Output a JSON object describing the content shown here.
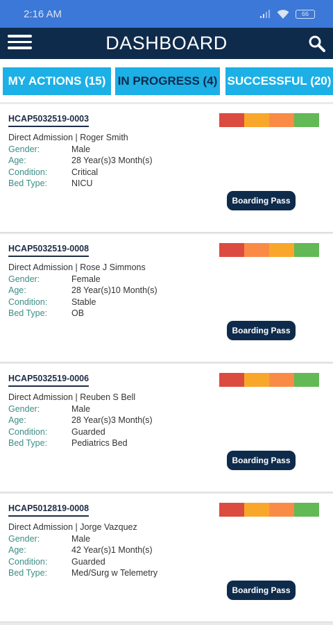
{
  "status_bar": {
    "time": "2:16 AM",
    "battery": "66"
  },
  "app_bar": {
    "title": "DASHBOARD"
  },
  "tabs": [
    {
      "label": "MY ACTIONS (15)"
    },
    {
      "label": "IN PROGRESS (4)"
    },
    {
      "label": "SUCCESSFUL (20)"
    }
  ],
  "detail_labels": {
    "gender": "Gender:",
    "age": "Age:",
    "condition": "Condition:",
    "bed_type": "Bed Type:"
  },
  "boarding_pass_label": "Boarding Pass",
  "priority_colors": {
    "red": "#dc4b3f",
    "amber": "#f8a72b",
    "orange": "#f98b47",
    "green": "#62b955"
  },
  "cards": [
    {
      "id": "HCAP5032519-0003",
      "admission": "Direct Admission | Roger Smith",
      "gender": "Male",
      "age": "28 Year(s)3 Month(s)",
      "condition": "Critical",
      "bed_type": "NICU",
      "priority_bar": [
        "#dc4b3f",
        "#f8a72b",
        "#f98b47",
        "#62b955"
      ]
    },
    {
      "id": "HCAP5032519-0008",
      "admission": "Direct Admission | Rose J Simmons",
      "gender": "Female",
      "age": "28 Year(s)10 Month(s)",
      "condition": "Stable",
      "bed_type": "OB",
      "priority_bar": [
        "#dc4b3f",
        "#f98b47",
        "#f8a72b",
        "#62b955"
      ]
    },
    {
      "id": "HCAP5032519-0006",
      "admission": "Direct Admission | Reuben S Bell",
      "gender": "Male",
      "age": "28 Year(s)3 Month(s)",
      "condition": "Guarded",
      "bed_type": "Pediatrics Bed",
      "priority_bar": [
        "#dc4b3f",
        "#f8a72b",
        "#f98b47",
        "#62b955"
      ]
    },
    {
      "id": "HCAP5012819-0008",
      "admission": "Direct Admission | Jorge Vazquez",
      "gender": "Male",
      "age": "42 Year(s)1 Month(s)",
      "condition": "Guarded",
      "bed_type": "Med/Surg  w Telemetry",
      "priority_bar": [
        "#dc4b3f",
        "#f8a72b",
        "#f98b47",
        "#62b955"
      ]
    }
  ]
}
